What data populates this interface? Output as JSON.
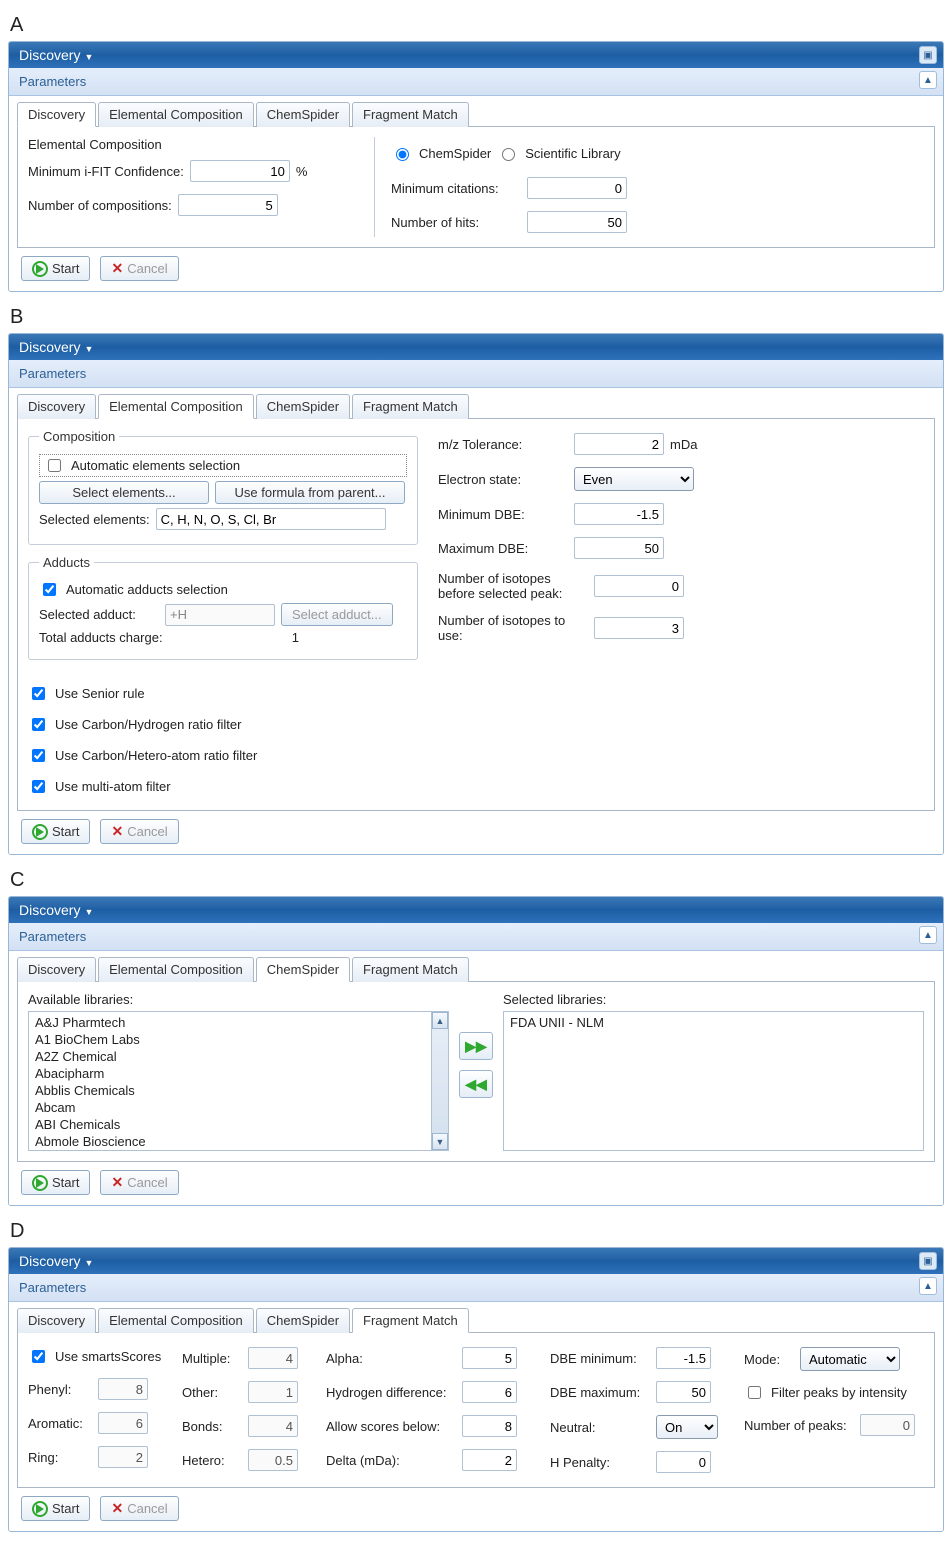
{
  "letters": {
    "a": "A",
    "b": "B",
    "c": "C",
    "d": "D"
  },
  "win": {
    "title": "Discovery",
    "params": "Parameters",
    "collapse": "▣",
    "up": "▲"
  },
  "tabs": {
    "discovery": "Discovery",
    "elem": "Elemental Composition",
    "chem": "ChemSpider",
    "frag": "Fragment Match"
  },
  "btns": {
    "start": "Start",
    "cancel": "Cancel",
    "selectElems": "Select elements...",
    "useFormula": "Use formula from parent...",
    "selectAdduct": "Select adduct..."
  },
  "A": {
    "ec_title": "Elemental Composition",
    "min_ifit_label": "Minimum i-FIT Confidence:",
    "min_ifit": "10",
    "pct": "%",
    "num_comp_label": "Number of compositions:",
    "num_comp": "5",
    "src_chem": "ChemSpider",
    "src_sci": "Scientific Library",
    "min_cit_label": "Minimum citations:",
    "min_cit": "0",
    "hits_label": "Number of hits:",
    "hits": "50"
  },
  "B": {
    "comp": "Composition",
    "auto_elems": "Automatic elements selection",
    "sel_elems_label": "Selected elements:",
    "sel_elems": "C, H, N, O, S, Cl, Br",
    "adducts": "Adducts",
    "auto_add": "Automatic adducts selection",
    "sel_add_label": "Selected adduct:",
    "sel_add": "+H",
    "tot_charge_label": "Total adducts charge:",
    "tot_charge": "1",
    "mz_label": "m/z Tolerance:",
    "mz": "2",
    "mda": "mDa",
    "elec_label": "Electron state:",
    "elec": "Even",
    "mindbe_label": "Minimum DBE:",
    "mindbe": "-1.5",
    "maxdbe_label": "Maximum DBE:",
    "maxdbe": "50",
    "iso_before_label": "Number of isotopes before selected peak:",
    "iso_before": "0",
    "iso_use_label": "Number of isotopes to use:",
    "iso_use": "3",
    "f1": "Use Senior rule",
    "f2": "Use Carbon/Hydrogen ratio filter",
    "f3": "Use Carbon/Hetero-atom ratio filter",
    "f4": "Use multi-atom filter"
  },
  "C": {
    "avail": "Available libraries:",
    "sel": "Selected libraries:",
    "libs": [
      "A&J Pharmtech",
      "A1 BioChem Labs",
      "A2Z Chemical",
      "Abacipharm",
      "Abblis Chemicals",
      "Abcam",
      "ABI Chemicals",
      "Abmole Bioscience"
    ],
    "picked": "FDA UNII - NLM"
  },
  "D": {
    "smarts": "Use smartsScores",
    "phenyl_l": "Phenyl:",
    "phenyl": "8",
    "aromatic_l": "Aromatic:",
    "aromatic": "6",
    "ring_l": "Ring:",
    "ring": "2",
    "mult_l": "Multiple:",
    "mult": "4",
    "other_l": "Other:",
    "other": "1",
    "bonds_l": "Bonds:",
    "bonds": "4",
    "hetero_l": "Hetero:",
    "hetero": "0.5",
    "alpha_l": "Alpha:",
    "alpha": "5",
    "hdiff_l": "Hydrogen difference:",
    "hdiff": "6",
    "allow_l": "Allow scores below:",
    "allow": "8",
    "delta_l": "Delta (mDa):",
    "delta": "2",
    "dbemin_l": "DBE minimum:",
    "dbemin": "-1.5",
    "dbemax_l": "DBE maximum:",
    "dbemax": "50",
    "neutral_l": "Neutral:",
    "neutral": "On",
    "hpen_l": "H Penalty:",
    "hpen": "0",
    "mode_l": "Mode:",
    "mode": "Automatic",
    "filt": "Filter peaks by intensity",
    "npeaks_l": "Number of peaks:",
    "npeaks": "0"
  }
}
